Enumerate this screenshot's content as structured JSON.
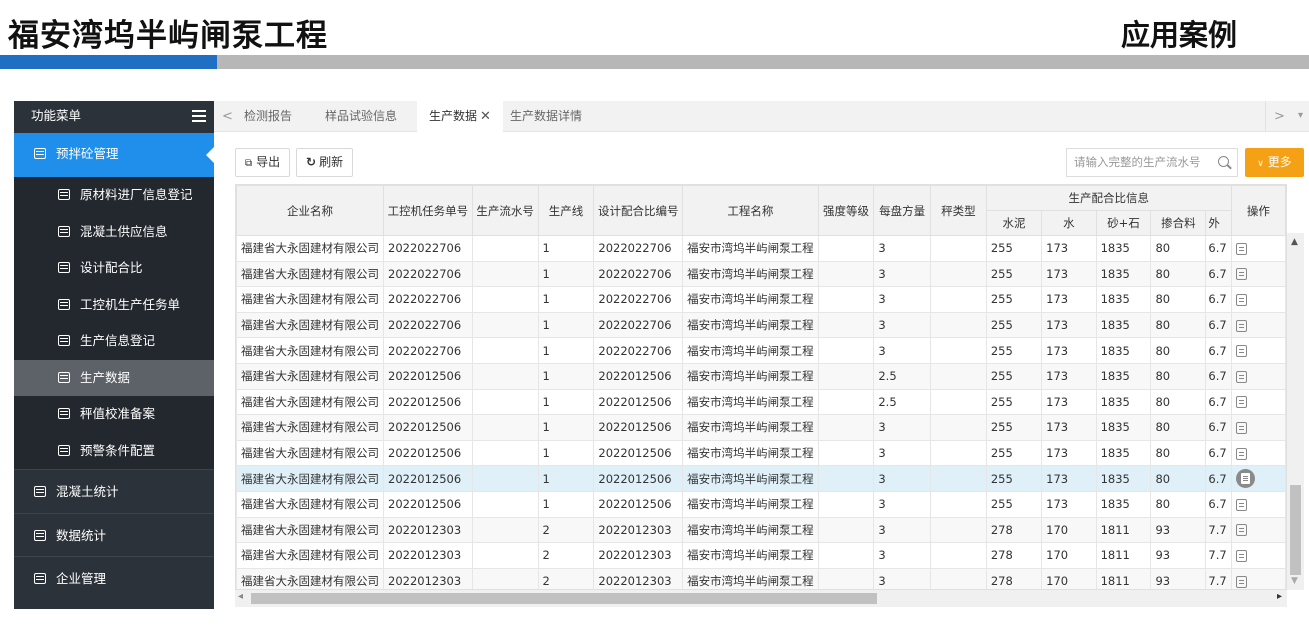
{
  "slide": {
    "title": "福安湾坞半屿闸泵工程",
    "right_title": "应用案例"
  },
  "sidebar": {
    "header": "功能菜单",
    "active_group": "预拌砼管理",
    "sub_items": [
      {
        "label": "原材料进厂信息登记"
      },
      {
        "label": "混凝土供应信息"
      },
      {
        "label": "设计配合比"
      },
      {
        "label": "工控机生产任务单"
      },
      {
        "label": "生产信息登记"
      },
      {
        "label": "生产数据",
        "selected": true
      },
      {
        "label": "秤值校准备案"
      },
      {
        "label": "预警条件配置"
      }
    ],
    "groups": [
      {
        "label": "混凝土统计"
      },
      {
        "label": "数据统计"
      },
      {
        "label": "企业管理"
      }
    ]
  },
  "tabs": [
    {
      "label": "检测报告"
    },
    {
      "label": "样品试验信息"
    },
    {
      "label": "生产数据",
      "active": true
    },
    {
      "label": "生产数据详情"
    }
  ],
  "tab_nav": {
    "prev": "<",
    "next": ">",
    "menu": "▾"
  },
  "toolbar": {
    "export": "导出",
    "refresh": "刷新",
    "search_placeholder": "请输入完整的生产流水号",
    "more": "更多"
  },
  "table": {
    "headers": {
      "company": "企业名称",
      "task_no": "工控机任务单号",
      "serial": "生产流水号",
      "line": "生产线",
      "mix_code": "设计配合比编号",
      "project": "工程名称",
      "grade": "强度等级",
      "per_batch": "每盘方量",
      "scale": "秤类型",
      "group": "生产配合比信息",
      "cement": "水泥",
      "water": "水",
      "sand_stone": "砂+石",
      "admix": "掺合料",
      "extra": "外",
      "op": "操作"
    },
    "rows": [
      {
        "company": "福建省大永固建材有限公司",
        "task_no": "2022022706",
        "serial": "",
        "line": "1",
        "mix_code": "2022022706",
        "project": "福安市湾坞半屿闸泵工程",
        "grade": "",
        "per_batch": "3",
        "scale": "",
        "cement": "255",
        "water": "173",
        "sand_stone": "1835",
        "admix": "80",
        "extra": "6.7"
      },
      {
        "company": "福建省大永固建材有限公司",
        "task_no": "2022022706",
        "serial": "",
        "line": "1",
        "mix_code": "2022022706",
        "project": "福安市湾坞半屿闸泵工程",
        "grade": "",
        "per_batch": "3",
        "scale": "",
        "cement": "255",
        "water": "173",
        "sand_stone": "1835",
        "admix": "80",
        "extra": "6.7"
      },
      {
        "company": "福建省大永固建材有限公司",
        "task_no": "2022022706",
        "serial": "",
        "line": "1",
        "mix_code": "2022022706",
        "project": "福安市湾坞半屿闸泵工程",
        "grade": "",
        "per_batch": "3",
        "scale": "",
        "cement": "255",
        "water": "173",
        "sand_stone": "1835",
        "admix": "80",
        "extra": "6.7"
      },
      {
        "company": "福建省大永固建材有限公司",
        "task_no": "2022022706",
        "serial": "",
        "line": "1",
        "mix_code": "2022022706",
        "project": "福安市湾坞半屿闸泵工程",
        "grade": "",
        "per_batch": "3",
        "scale": "",
        "cement": "255",
        "water": "173",
        "sand_stone": "1835",
        "admix": "80",
        "extra": "6.7"
      },
      {
        "company": "福建省大永固建材有限公司",
        "task_no": "2022022706",
        "serial": "",
        "line": "1",
        "mix_code": "2022022706",
        "project": "福安市湾坞半屿闸泵工程",
        "grade": "",
        "per_batch": "3",
        "scale": "",
        "cement": "255",
        "water": "173",
        "sand_stone": "1835",
        "admix": "80",
        "extra": "6.7"
      },
      {
        "company": "福建省大永固建材有限公司",
        "task_no": "2022012506",
        "serial": "",
        "line": "1",
        "mix_code": "2022012506",
        "project": "福安市湾坞半屿闸泵工程",
        "grade": "",
        "per_batch": "2.5",
        "scale": "",
        "cement": "255",
        "water": "173",
        "sand_stone": "1835",
        "admix": "80",
        "extra": "6.7"
      },
      {
        "company": "福建省大永固建材有限公司",
        "task_no": "2022012506",
        "serial": "",
        "line": "1",
        "mix_code": "2022012506",
        "project": "福安市湾坞半屿闸泵工程",
        "grade": "",
        "per_batch": "2.5",
        "scale": "",
        "cement": "255",
        "water": "173",
        "sand_stone": "1835",
        "admix": "80",
        "extra": "6.7"
      },
      {
        "company": "福建省大永固建材有限公司",
        "task_no": "2022012506",
        "serial": "",
        "line": "1",
        "mix_code": "2022012506",
        "project": "福安市湾坞半屿闸泵工程",
        "grade": "",
        "per_batch": "3",
        "scale": "",
        "cement": "255",
        "water": "173",
        "sand_stone": "1835",
        "admix": "80",
        "extra": "6.7"
      },
      {
        "company": "福建省大永固建材有限公司",
        "task_no": "2022012506",
        "serial": "",
        "line": "1",
        "mix_code": "2022012506",
        "project": "福安市湾坞半屿闸泵工程",
        "grade": "",
        "per_batch": "3",
        "scale": "",
        "cement": "255",
        "water": "173",
        "sand_stone": "1835",
        "admix": "80",
        "extra": "6.7"
      },
      {
        "company": "福建省大永固建材有限公司",
        "task_no": "2022012506",
        "serial": "",
        "line": "1",
        "mix_code": "2022012506",
        "project": "福安市湾坞半屿闸泵工程",
        "grade": "",
        "per_batch": "3",
        "scale": "",
        "cement": "255",
        "water": "173",
        "sand_stone": "1835",
        "admix": "80",
        "extra": "6.7",
        "highlighted": true
      },
      {
        "company": "福建省大永固建材有限公司",
        "task_no": "2022012506",
        "serial": "",
        "line": "1",
        "mix_code": "2022012506",
        "project": "福安市湾坞半屿闸泵工程",
        "grade": "",
        "per_batch": "3",
        "scale": "",
        "cement": "255",
        "water": "173",
        "sand_stone": "1835",
        "admix": "80",
        "extra": "6.7"
      },
      {
        "company": "福建省大永固建材有限公司",
        "task_no": "2022012303",
        "serial": "",
        "line": "2",
        "mix_code": "2022012303",
        "project": "福安市湾坞半屿闸泵工程",
        "grade": "",
        "per_batch": "3",
        "scale": "",
        "cement": "278",
        "water": "170",
        "sand_stone": "1811",
        "admix": "93",
        "extra": "7.7"
      },
      {
        "company": "福建省大永固建材有限公司",
        "task_no": "2022012303",
        "serial": "",
        "line": "2",
        "mix_code": "2022012303",
        "project": "福安市湾坞半屿闸泵工程",
        "grade": "",
        "per_batch": "3",
        "scale": "",
        "cement": "278",
        "water": "170",
        "sand_stone": "1811",
        "admix": "93",
        "extra": "7.7"
      },
      {
        "company": "福建省大永固建材有限公司",
        "task_no": "2022012303",
        "serial": "",
        "line": "2",
        "mix_code": "2022012303",
        "project": "福安市湾坞半屿闸泵工程",
        "grade": "",
        "per_batch": "3",
        "scale": "",
        "cement": "278",
        "water": "170",
        "sand_stone": "1811",
        "admix": "93",
        "extra": "7.7"
      }
    ]
  },
  "colors": {
    "accent_blue": "#1f8feb",
    "stripe_blue": "#1f6fc5",
    "more_orange": "#f5a116",
    "sidebar_bg": "#2c3239"
  }
}
